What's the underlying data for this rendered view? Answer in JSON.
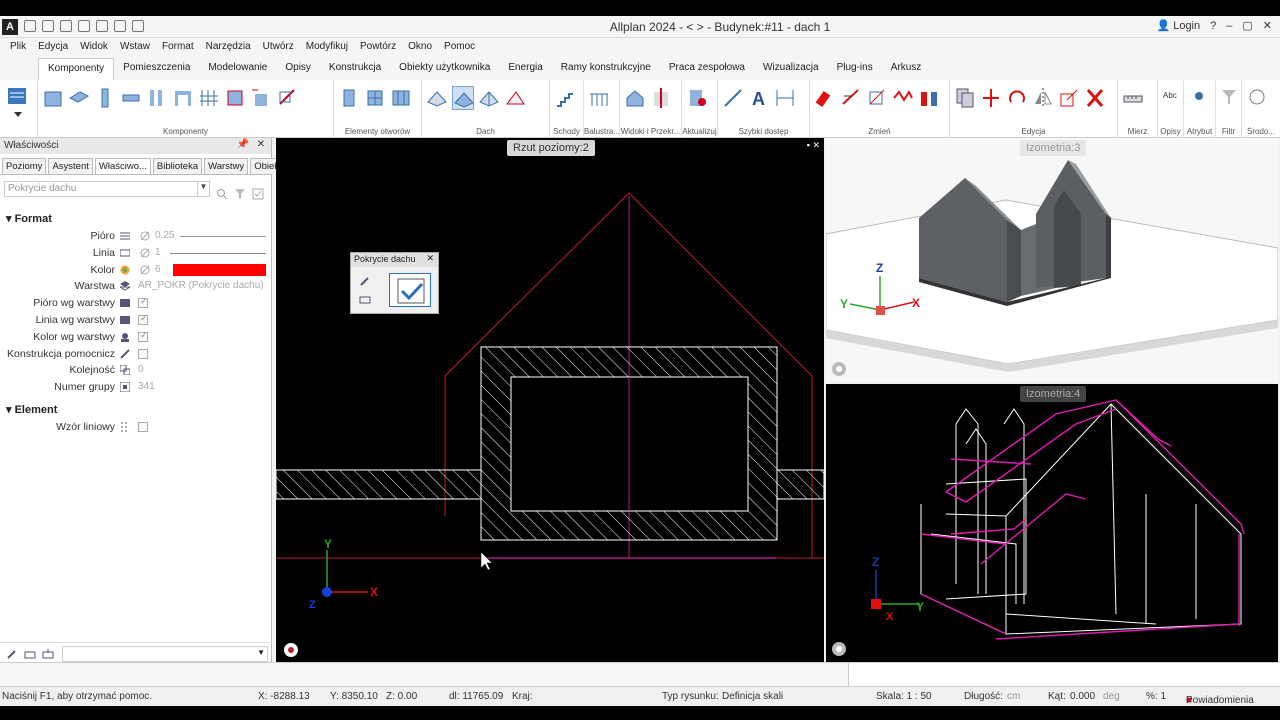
{
  "app": {
    "title": "Allplan 2024 - <        > - Budynek:#11 - dach 1",
    "login": "Login"
  },
  "menu": [
    "Plik",
    "Edycja",
    "Widok",
    "Wstaw",
    "Format",
    "Narzędzia",
    "Utwórz",
    "Modyfikuj",
    "Powtórz",
    "Okno",
    "Pomoc"
  ],
  "ribbon_tabs": [
    "Komponenty",
    "Pomieszczenia",
    "Modelowanie",
    "Opisy",
    "Konstrukcja",
    "Obiekty użytkownika",
    "Energia",
    "Ramy konstrukcyjne",
    "Praca zespołowa",
    "Wizualizacja",
    "Plug-ins",
    "Arkusz"
  ],
  "ribbon_groups": [
    "Komponenty",
    "Elementy otworów",
    "Dach",
    "Schody",
    "Balustra...",
    "Widoki i Przekr...",
    "Aktualizuj",
    "Szybki dostęp",
    "Zmień",
    "Edycja",
    "Mierz",
    "Opisy",
    "Atrybut",
    "Filtr",
    "Środo..."
  ],
  "props": {
    "title": "Właściwości",
    "tabs": [
      "Poziomy",
      "Asystent",
      "Właściwo...",
      "Biblioteka",
      "Warstwy",
      "Obiekty"
    ],
    "dropdown_placeholder": "Pokrycie dachu",
    "section_format": "Format",
    "section_element": "Element",
    "rows": {
      "pioro": {
        "label": "Pióro",
        "value": "0.25"
      },
      "linia": {
        "label": "Linia",
        "value": "1"
      },
      "kolor": {
        "label": "Kolor",
        "value": "6"
      },
      "warstwa": {
        "label": "Warstwa",
        "value": "AR_POKR (Pokrycie dachu)"
      },
      "pioro_wg": {
        "label": "Pióro wg warstwy"
      },
      "linia_wg": {
        "label": "Linia wg warstwy"
      },
      "kolor_wg": {
        "label": "Kolor wg warstwy"
      },
      "konstrukcja": {
        "label": "Konstrukcja pomocnicz"
      },
      "kolejnosc": {
        "label": "Kolejność",
        "value": "0"
      },
      "numer_grupy": {
        "label": "Numer grupy",
        "value": "341"
      },
      "wzor": {
        "label": "Wzór liniowy"
      }
    },
    "color_swatch": "#ff0000"
  },
  "viewports": {
    "plan": "Rzut poziomy:2",
    "iso3": "Izometria:3",
    "iso4": "Izometria:4"
  },
  "palette": {
    "title": "Pokrycie dachu"
  },
  "status": {
    "help": "Naciśnij F1, aby otrzymać pomoc.",
    "x": "X:   -8288.13",
    "y": "Y:   8350.10",
    "z": "Z:   0.00",
    "dl": "dl:  11765.09",
    "kraj": "Kraj:",
    "typ_label": "Typ rysunku:",
    "typ_value": "Definicja skali",
    "skala": "Skala:   1 : 50",
    "dlugosc_label": "Długość:",
    "dlugosc_unit": "cm",
    "kat_label": "Kąt:",
    "kat_value": "0.000",
    "kat_unit": "deg",
    "pct": "%:   1",
    "notif": "Powiadomienia"
  }
}
